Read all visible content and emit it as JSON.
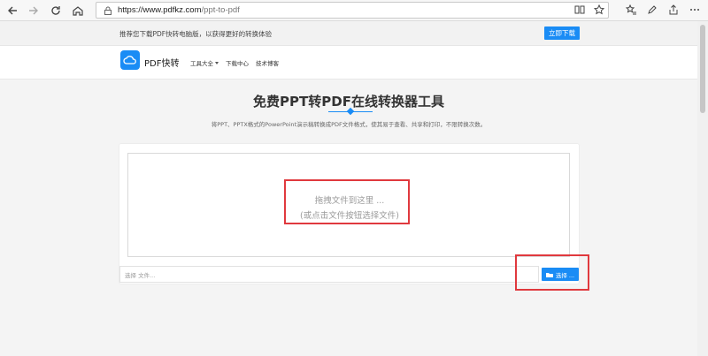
{
  "browser": {
    "url_host": "https://www.pdfkz.com",
    "url_path": "/ppt-to-pdf"
  },
  "notice": {
    "text": "推荐您下载PDF快转电脑版，以获得更好的转换体验",
    "button": "立即下载"
  },
  "header": {
    "brand": "PDF快转",
    "menu": [
      "工具大全",
      "下载中心",
      "技术博客"
    ]
  },
  "main": {
    "title": "免费PPT转PDF在线转换器工具",
    "subtitle": "将PPT、PPTX格式的PowerPoint演示稿转换成PDF文件格式，使其易于查看、共享和打印，不限转换次数。",
    "dropzone_line1": "拖拽文件到这里 ...",
    "dropzone_line2": "(或点击文件按钮选择文件)",
    "file_placeholder": "选择 文件...",
    "choose_button": "选择 ..."
  },
  "colors": {
    "accent": "#1a8cf5",
    "highlight": "#e0393e"
  }
}
